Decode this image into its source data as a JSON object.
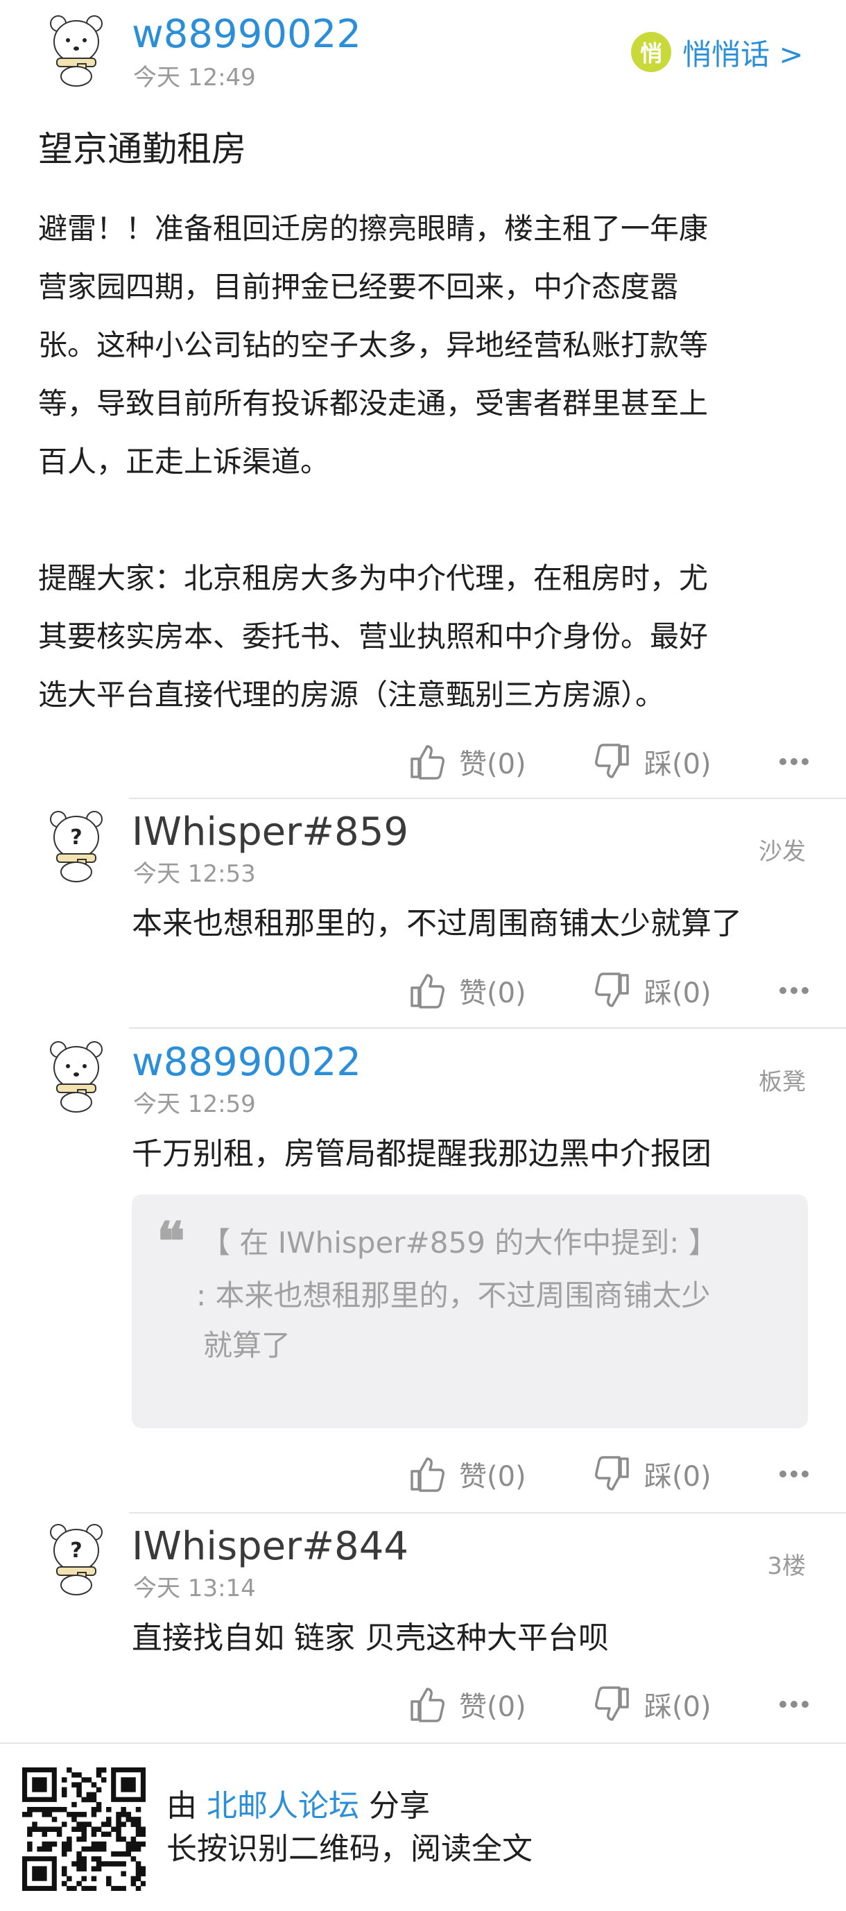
{
  "main_post": {
    "author": "w88990022",
    "time": "今天 12:49",
    "quiet_badge": "悄",
    "quiet_label": "悄悄话 >",
    "title": "望京通勤租房",
    "body_lines": [
      "避雷！！准备租回迁房的擦亮眼睛，楼主租了一年康",
      "营家园四期，目前押金已经要不回来，中介态度嚣",
      "张。这种小公司钻的空子太多，异地经营私账打款等",
      "等，导致目前所有投诉都没走通，受害者群里甚至上",
      "百人，正走上诉渠道。",
      "",
      "提醒大家：北京租房大多为中介代理，在租房时，尤",
      "其要核实房本、委托书、营业执照和中介身份。最好",
      "选大平台直接代理的房源（注意甄别三方房源）。"
    ],
    "like_label": "赞(0)",
    "dislike_label": "踩(0)"
  },
  "replies": [
    {
      "author": "IWhisper#859",
      "time": "今天 12:53",
      "floor": "沙发",
      "text": "本来也想租那里的，不过周围商铺太少就算了",
      "like_label": "赞(0)",
      "dislike_label": "踩(0)"
    },
    {
      "author": "w88990022",
      "time": "今天 12:59",
      "floor": "板凳",
      "text": "千万别租，房管局都提醒我那边黑中介报团",
      "quote": {
        "head": "【 在 IWhisper#859 的大作中提到: 】",
        "body_line1": ": 本来也想租那里的，不过周围商铺太少",
        "body_line2": "就算了"
      },
      "like_label": "赞(0)",
      "dislike_label": "踩(0)"
    },
    {
      "author": "IWhisper#844",
      "time": "今天 13:14",
      "floor": "3楼",
      "text": "直接找自如 链家 贝壳这种大平台呗",
      "like_label": "赞(0)",
      "dislike_label": "踩(0)"
    }
  ],
  "footer": {
    "share_prefix": "由 ",
    "forum_name": "北邮人论坛",
    "share_suffix": " 分享",
    "hint": "长按识别二维码，阅读全文"
  },
  "colors": {
    "accent_blue": "#2a8fd8",
    "quiet_badge": "#c9d93a",
    "muted_text": "#9a9a9a",
    "quote_bg": "#f0f0f2"
  },
  "icons": [
    "bear-avatar-icon",
    "question-bear-avatar-icon",
    "thumbs-up-icon",
    "thumbs-down-icon",
    "more-icon",
    "qr-code-icon"
  ]
}
